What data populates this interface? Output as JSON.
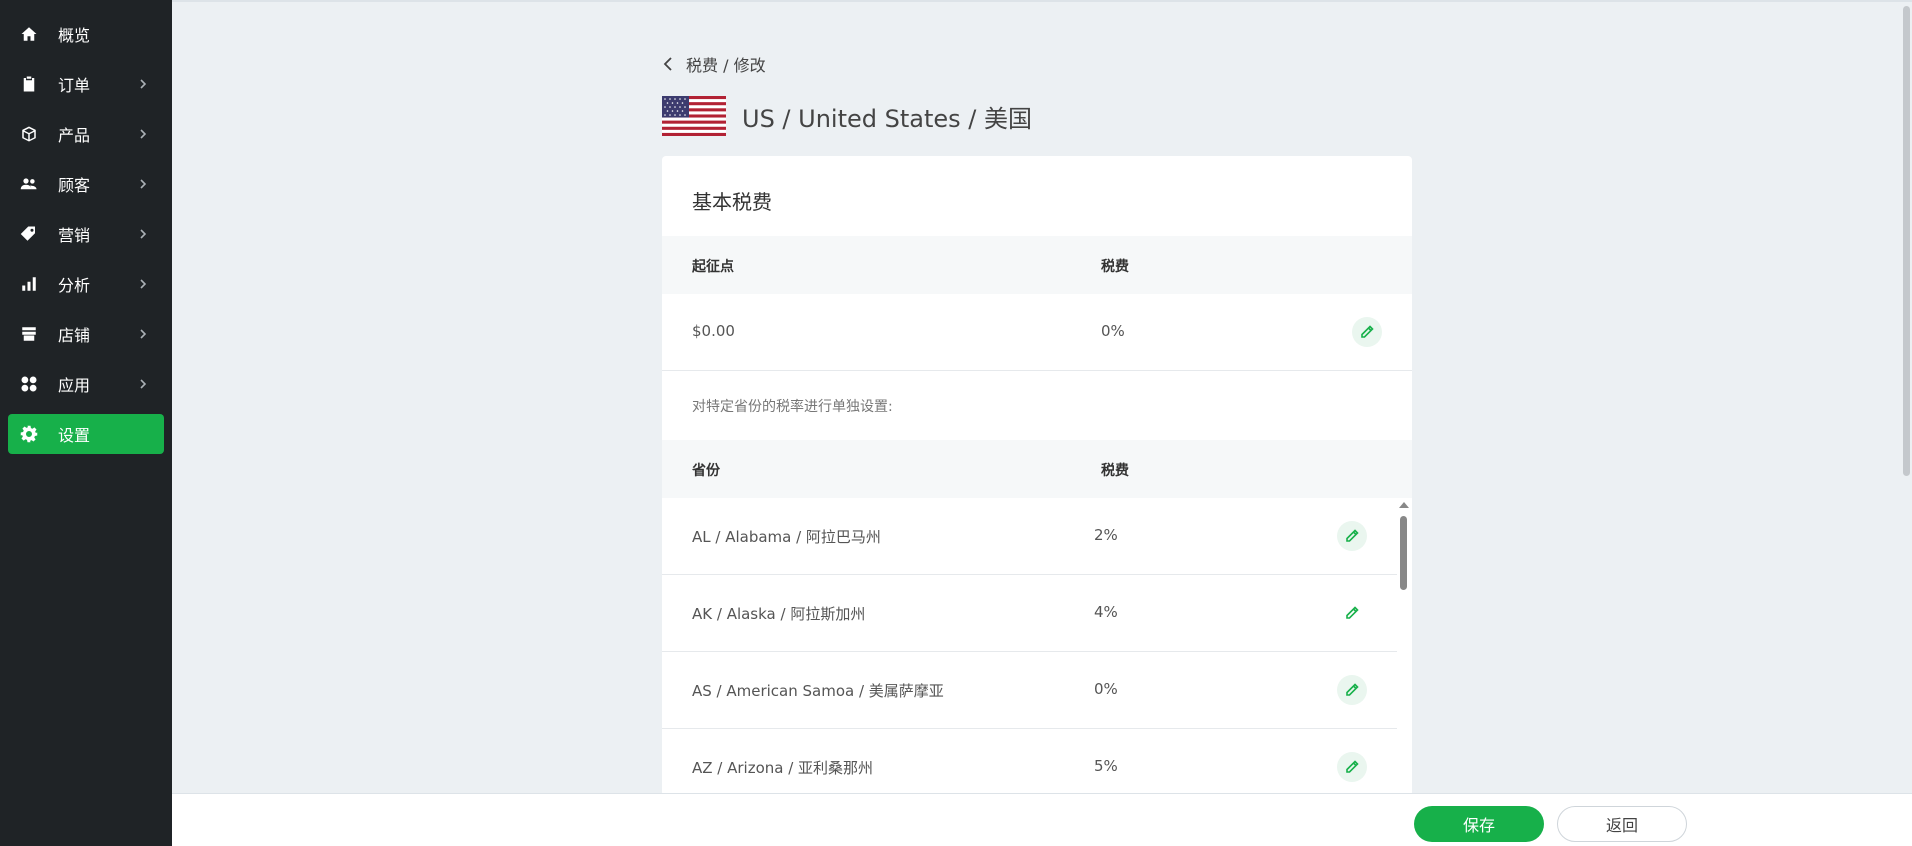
{
  "sidebar": {
    "items": [
      {
        "label": "概览",
        "icon": "home-icon",
        "has_chevron": false
      },
      {
        "label": "订单",
        "icon": "clipboard-icon",
        "has_chevron": true
      },
      {
        "label": "产品",
        "icon": "box-icon",
        "has_chevron": true
      },
      {
        "label": "顾客",
        "icon": "users-icon",
        "has_chevron": true
      },
      {
        "label": "营销",
        "icon": "tag-icon",
        "has_chevron": true
      },
      {
        "label": "分析",
        "icon": "bar-chart-icon",
        "has_chevron": true
      },
      {
        "label": "店铺",
        "icon": "store-icon",
        "has_chevron": true
      },
      {
        "label": "应用",
        "icon": "apps-icon",
        "has_chevron": true
      },
      {
        "label": "设置",
        "icon": "gear-icon",
        "has_chevron": false,
        "active": true
      }
    ]
  },
  "breadcrumb": {
    "text": "税费 / 修改"
  },
  "header": {
    "title": "US / United States / 美国",
    "flag": "us-flag-icon"
  },
  "base_tax": {
    "title": "基本税费",
    "columns": [
      "起征点",
      "税费"
    ],
    "row": {
      "threshold": "$0.00",
      "rate": "0%"
    }
  },
  "province_note": "对特定省份的税率进行单独设置:",
  "provinces": {
    "columns": [
      "省份",
      "税费"
    ],
    "rows": [
      {
        "name": "AL / Alabama / 阿拉巴马州",
        "rate": "2%"
      },
      {
        "name": "AK / Alaska / 阿拉斯加州",
        "rate": "4%"
      },
      {
        "name": "AS / American Samoa / 美属萨摩亚",
        "rate": "0%"
      },
      {
        "name": "AZ / Arizona / 亚利桑那州",
        "rate": "5%"
      }
    ]
  },
  "footer": {
    "save_label": "保存",
    "back_label": "返回"
  },
  "colors": {
    "accent": "#17b04a",
    "sidebar_bg": "#1f2326",
    "page_bg": "#ecf0f3"
  }
}
